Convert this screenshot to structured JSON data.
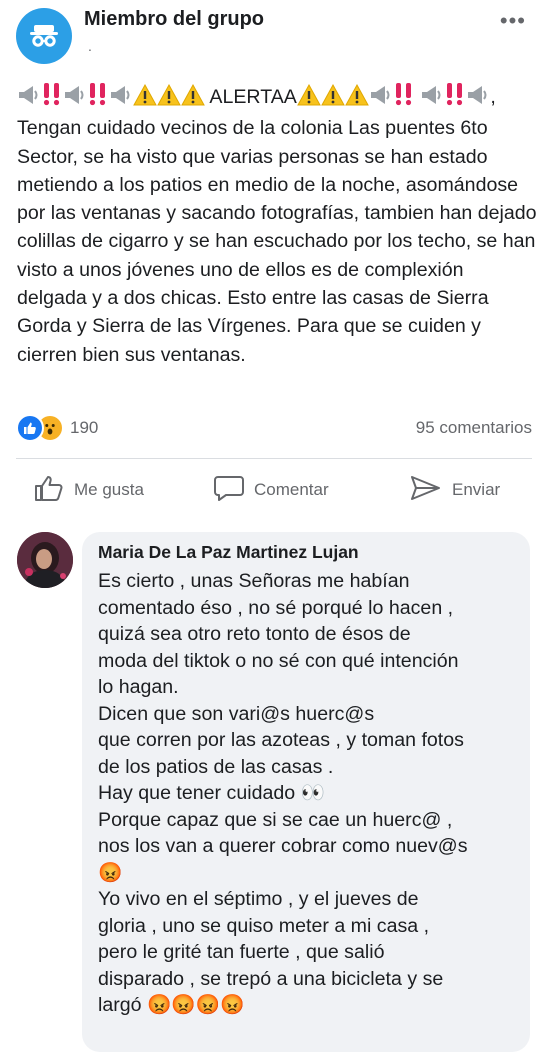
{
  "post": {
    "author": "Miembro del grupo",
    "subtitle": ".",
    "more_label": "•••",
    "alert_word": "ALERTAA",
    "body": ", Tengan cuidado vecinos de la colonia Las puentes 6to Sector, se ha visto que varias personas se han estado metiendo a los patios en medio de la noche, asomándose por las ventanas y sacando fotografías, tambien han dejado colillas de cigarro y se han escuchado por los techo, se han visto a unos jóvenes uno de ellos es de complexión delgada y a dos chicas. Esto entre las casas de Sierra Gorda y Sierra de las Vírgenes. Para que se cuiden y cierren bien sus ventanas.",
    "emoji_sequence": [
      "loudspeaker",
      "double-exclamation",
      "loudspeaker",
      "double-exclamation",
      "loudspeaker",
      "warning",
      "warning",
      "warning"
    ]
  },
  "stats": {
    "reaction_count": "190",
    "comments": "95 comentarios"
  },
  "actions": {
    "like": "Me gusta",
    "comment": "Comentar",
    "share": "Enviar"
  },
  "comment": {
    "name": "Maria De La Paz Martinez Lujan",
    "lines": [
      "Es cierto , unas Señoras me habían",
      "comentado éso , no sé porqué lo hacen ,",
      "quizá sea otro reto tonto de ésos de",
      "moda del tiktok o no sé con qué intención",
      "lo hagan.",
      "Dicen que son vari@s huerc@s",
      "que corren por las azoteas , y toman fotos",
      "de los patios de las casas .",
      "Hay que tener cuidado 👀",
      "Porque capaz que si se cae un huerc@ ,",
      "nos los van a querer cobrar como nuev@s",
      "😡",
      "Yo vivo en el séptimo , y el jueves de",
      "gloria , uno se quiso meter a mi casa ,",
      "pero le grité tan fuerte , que salió",
      "disparado , se trepó a una bicicleta y se",
      "largó 😡😡😡😡"
    ]
  },
  "icons": {
    "group_avatar": "anonymous-member-icon",
    "reactions": [
      "like-reaction-icon",
      "wow-reaction-icon"
    ],
    "like": "thumb-up-icon",
    "comment": "comment-bubble-icon",
    "share": "send-arrow-icon"
  },
  "colors": {
    "accent": "#1877f2",
    "muted": "#65676b",
    "bubble": "#f0f2f5",
    "avatar": "#2c9fe6",
    "alert_red": "#e0245e",
    "warning_yellow": "#f7c21c"
  }
}
